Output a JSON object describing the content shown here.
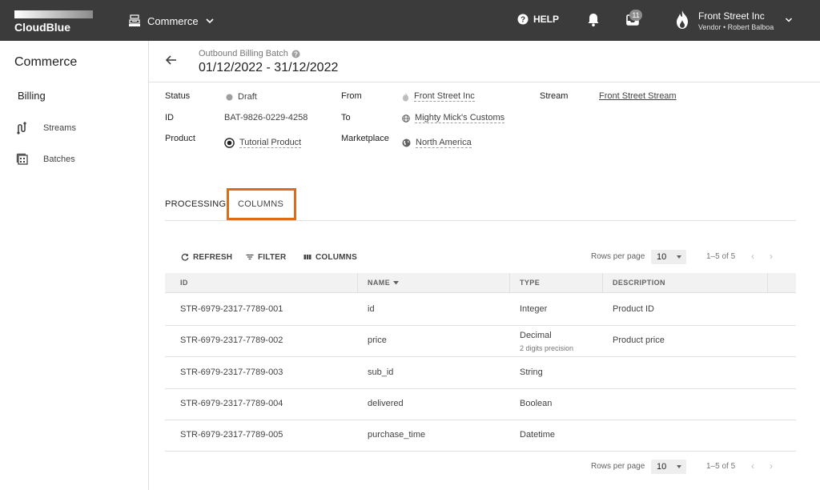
{
  "topbar": {
    "logo_text": "CloudBlue",
    "app_name": "Commerce",
    "help_label": "HELP",
    "inbox_count": "11",
    "account_name": "Front Street Inc",
    "account_sub": "Vendor • Robert Balboa"
  },
  "sidebar": {
    "title": "Commerce",
    "section": "Billing",
    "items": [
      {
        "label": "Streams",
        "icon": "streams-icon"
      },
      {
        "label": "Batches",
        "icon": "batches-icon"
      }
    ]
  },
  "header": {
    "subtitle": "Outbound Billing Batch",
    "title": "01/12/2022 - 31/12/2022"
  },
  "details": {
    "status_label": "Status",
    "status_value": "Draft",
    "id_label": "ID",
    "id_value": "BAT-9826-0229-4258",
    "product_label": "Product",
    "product_value": "Tutorial Product",
    "from_label": "From",
    "from_value": "Front Street Inc",
    "to_label": "To",
    "to_value": "Mighty Mick's Customs",
    "marketplace_label": "Marketplace",
    "marketplace_value": "North America",
    "stream_label": "Stream",
    "stream_value": "Front Street Stream"
  },
  "tabs": [
    {
      "label": "PROCESSING",
      "active": false
    },
    {
      "label": "COLUMNS",
      "active": true
    }
  ],
  "toolbar": {
    "refresh_label": "REFRESH",
    "filter_label": "FILTER",
    "columns_label": "COLUMNS",
    "rows_per_page_label": "Rows per page",
    "rows_per_page_value": "10",
    "page_range": "1–5 of 5"
  },
  "table": {
    "headers": [
      "ID",
      "NAME",
      "TYPE",
      "DESCRIPTION"
    ],
    "rows": [
      {
        "id": "STR-6979-2317-7789-001",
        "name": "id",
        "type": "Integer",
        "type_sub": "",
        "description": "Product ID"
      },
      {
        "id": "STR-6979-2317-7789-002",
        "name": "price",
        "type": "Decimal",
        "type_sub": "2 digits precision",
        "description": "Product price"
      },
      {
        "id": "STR-6979-2317-7789-003",
        "name": "sub_id",
        "type": "String",
        "type_sub": "",
        "description": ""
      },
      {
        "id": "STR-6979-2317-7789-004",
        "name": "delivered",
        "type": "Boolean",
        "type_sub": "",
        "description": ""
      },
      {
        "id": "STR-6979-2317-7789-005",
        "name": "purchase_time",
        "type": "Datetime",
        "type_sub": "",
        "description": ""
      }
    ]
  },
  "footer": {
    "rows_per_page_label": "Rows per page",
    "rows_per_page_value": "10",
    "page_range": "1–5 of 5"
  },
  "colors": {
    "topbar": "#3b3b3b",
    "highlight": "#e0691b"
  }
}
